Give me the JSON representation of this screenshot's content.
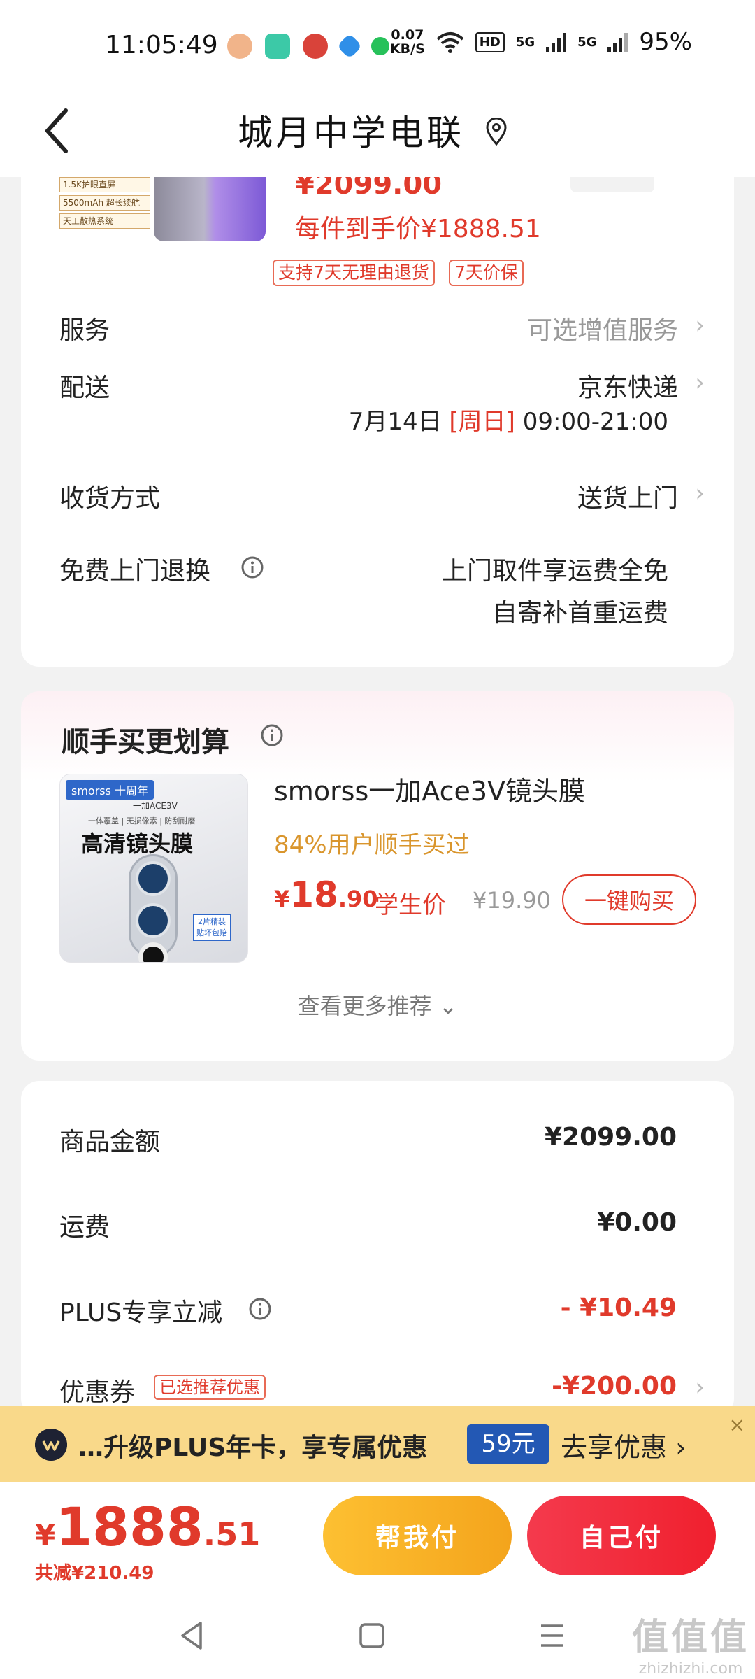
{
  "status_bar": {
    "time": "11:05:49",
    "speed_value": "0.07",
    "speed_unit": "KB/S",
    "hd": "HD",
    "net1": "5G",
    "net2": "5G",
    "battery": "95%"
  },
  "header": {
    "title": "城月中学电联"
  },
  "product": {
    "price_partial": "¥2099.00",
    "unit_price": "每件到手价¥1888.51",
    "tag1": "1.5K护眼直屏",
    "tag2": "5500mAh 超长续航",
    "tag3": "天工散热系统",
    "badges": [
      "支持7天无理由退货",
      "7天价保"
    ]
  },
  "service": {
    "label": "服务",
    "value": "可选增值服务"
  },
  "delivery": {
    "label": "配送",
    "carrier": "京东快递",
    "date": "7月14日",
    "weekday": "[周日]",
    "time": "09:00-21:00"
  },
  "receive": {
    "label": "收货方式",
    "value": "送货上门"
  },
  "free_return": {
    "label": "免费上门退换",
    "line1": "上门取件享运费全免",
    "line2": "自寄补首重运费"
  },
  "recommend": {
    "title": "顺手买更划算",
    "thumb_brand": "smorss 十周年",
    "thumb_sub": "一加ACE3V",
    "thumb_sub2": "一体覆盖 | 无损像素 | 防刮耐磨",
    "thumb_head": "高清镜头膜",
    "thumb_pack": "2片精装\n贴坏包赔",
    "name": "smorss一加Ace3V镜头膜",
    "ratio": "84%用户顺手买过",
    "currency": "¥",
    "price_int": "18",
    "price_dec": ".90",
    "student": "学生价",
    "orig_price": "¥19.90",
    "buy_label": "一键购买",
    "more": "查看更多推荐 ⌄"
  },
  "summary": {
    "goods_label": "商品金额",
    "goods_value": "¥2099.00",
    "shipping_label": "运费",
    "shipping_value": "¥0.00",
    "plus_label": "PLUS专享立减",
    "plus_value": "- ¥10.49",
    "coupon_label": "优惠券",
    "coupon_tag": "已选推荐优惠",
    "coupon_value": "-¥200.00"
  },
  "plus_banner": {
    "text": "…升级PLUS年卡，享专属优惠",
    "price": "59元",
    "cta": "去享优惠 ›",
    "close": "×"
  },
  "bottom": {
    "currency": "¥",
    "total_int": "1888",
    "total_dec": ".51",
    "discount": "共减¥210.49",
    "help_pay": "帮我付",
    "self_pay": "自己付"
  },
  "watermark": {
    "text": "zhizhizhi.com"
  },
  "colors": {
    "accent_red": "#e03a2b",
    "gold": "#d9952c",
    "plus_blue": "#2358b4",
    "yellow_btn": "#fdc032",
    "red_btn": "#f0202e"
  }
}
